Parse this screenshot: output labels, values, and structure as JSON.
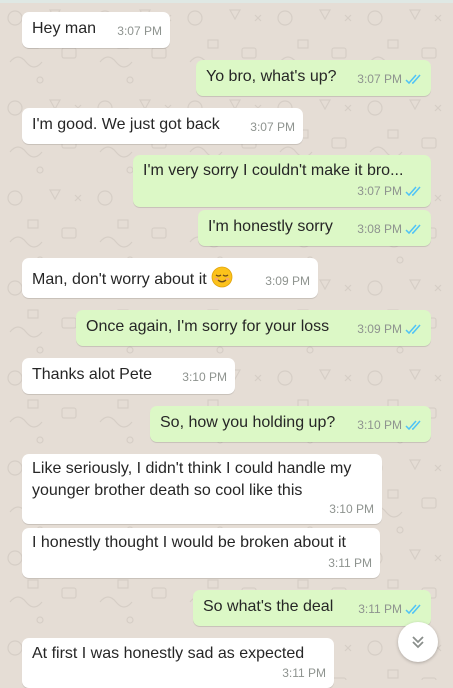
{
  "colors": {
    "wallpaper": "#e5ddd5",
    "incoming_bubble": "#ffffff",
    "outgoing_bubble": "#dcf8c6",
    "read_ticks": "#4fc3f7",
    "timestamp": "#8e938f"
  },
  "messages": [
    {
      "direction": "incoming",
      "text": "Hey man",
      "time": "3:07 PM"
    },
    {
      "direction": "outgoing",
      "text": "Yo bro, what's up?",
      "time": "3:07 PM",
      "status": "read"
    },
    {
      "direction": "incoming",
      "text": "I'm good. We just got back",
      "time": "3:07 PM"
    },
    {
      "direction": "outgoing",
      "text": "I'm very sorry I couldn't make it bro...",
      "time": "3:07 PM",
      "status": "read"
    },
    {
      "direction": "outgoing",
      "text": "I'm honestly sorry",
      "time": "3:08 PM",
      "status": "read"
    },
    {
      "direction": "incoming",
      "text": "Man, don't worry about it",
      "emoji": "relieved-face",
      "time": "3:09 PM"
    },
    {
      "direction": "outgoing",
      "text": "Once again, I'm sorry for your loss",
      "time": "3:09 PM",
      "status": "read"
    },
    {
      "direction": "incoming",
      "text": "Thanks alot Pete",
      "time": "3:10 PM"
    },
    {
      "direction": "outgoing",
      "text": "So, how you holding up?",
      "time": "3:10 PM",
      "status": "read"
    },
    {
      "direction": "incoming",
      "text": "Like seriously, I didn't think I could handle my younger brother death so cool like this",
      "time": "3:10 PM"
    },
    {
      "direction": "incoming",
      "text": "I honestly thought I would be broken about it",
      "time": "3:11 PM"
    },
    {
      "direction": "outgoing",
      "text": "So what's the deal",
      "time": "3:11 PM",
      "status": "read"
    },
    {
      "direction": "incoming",
      "text": "At first I was honestly sad as expected",
      "time": "3:11 PM"
    }
  ],
  "scroll_button": {
    "icon": "double-chevron-down-icon"
  }
}
